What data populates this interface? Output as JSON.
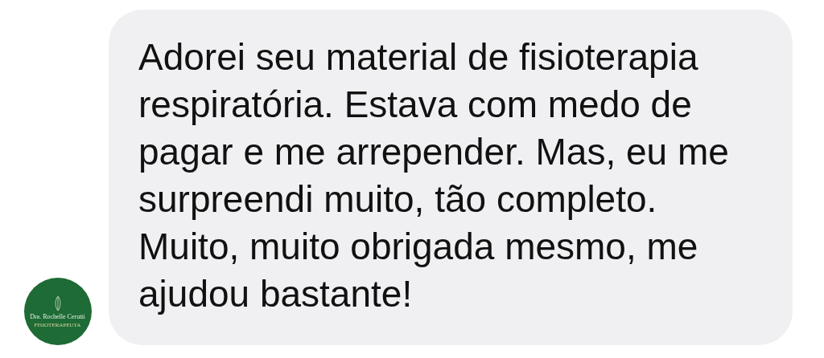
{
  "message": {
    "text": "Adorei seu material de fisioterapia\nrespiratória. Estava com medo de\npagar e me arrepender. Mas, eu me\nsurpreendi muito, tão completo.\nMuito, muito obrigada mesmo, me\najudou bastante!"
  },
  "avatar": {
    "name": "Dra. Rochelle Cerutti",
    "subtitle": "FISIOTERAPEUTA"
  }
}
